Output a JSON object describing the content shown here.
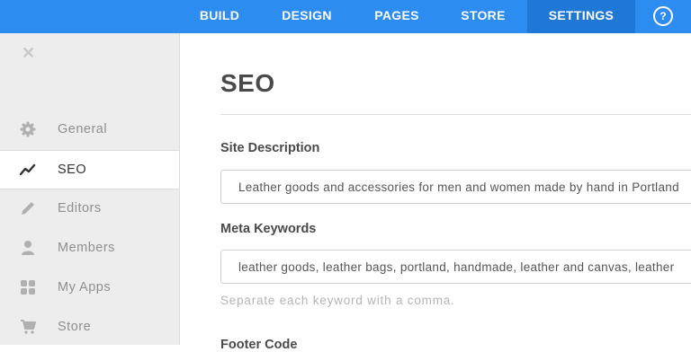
{
  "topnav": {
    "items": [
      {
        "label": "BUILD"
      },
      {
        "label": "DESIGN"
      },
      {
        "label": "PAGES"
      },
      {
        "label": "STORE"
      },
      {
        "label": "SETTINGS",
        "active": true
      }
    ],
    "help_glyph": "?",
    "accent": "#2d8cf0"
  },
  "sidebar": {
    "close_glyph": "✕",
    "items": [
      {
        "label": "General",
        "icon": "gear-icon"
      },
      {
        "label": "SEO",
        "icon": "trend-line-icon",
        "active": true
      },
      {
        "label": "Editors",
        "icon": "pencil-icon"
      },
      {
        "label": "Members",
        "icon": "person-icon"
      },
      {
        "label": "My Apps",
        "icon": "apps-grid-icon"
      },
      {
        "label": "Store",
        "icon": "cart-icon"
      }
    ]
  },
  "main": {
    "title": "SEO",
    "site_description": {
      "label": "Site Description",
      "value": "Leather goods and accessories for men and women made by hand in Portland"
    },
    "meta_keywords": {
      "label": "Meta Keywords",
      "value": "leather goods, leather bags, portland, handmade, leather and canvas, leather",
      "hint": "Separate each keyword with a comma."
    },
    "footer_code": {
      "label": "Footer Code"
    }
  }
}
